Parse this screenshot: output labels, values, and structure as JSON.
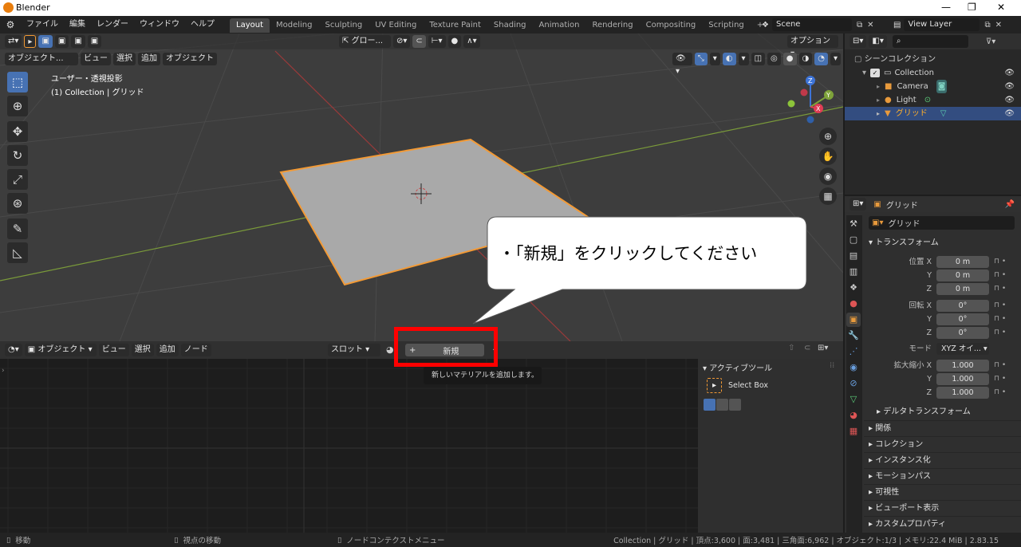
{
  "window": {
    "title": "Blender"
  },
  "menubar": {
    "menus": [
      "ファイル",
      "編集",
      "レンダー",
      "ウィンドウ",
      "ヘルプ"
    ],
    "workspaces": [
      "Layout",
      "Modeling",
      "Sculpting",
      "UV Editing",
      "Texture Paint",
      "Shading",
      "Animation",
      "Rendering",
      "Compositing",
      "Scripting"
    ],
    "add_tab": "+",
    "scene": "Scene",
    "view_layer": "View Layer"
  },
  "viewport": {
    "mode": "オブジェクト...",
    "menus": [
      "ビュー",
      "選択",
      "追加",
      "オブジェクト"
    ],
    "transform_orientation": "グロー...",
    "options": "オプション",
    "view_name": "ユーザー・透視投影",
    "view_info": "(1) Collection | グリッド",
    "gizmo": {
      "z": "Z",
      "y": "Y",
      "x": "X"
    }
  },
  "callout": {
    "text": "・「新規」をクリックしてください"
  },
  "node_editor": {
    "mode": "オブジェクト",
    "menus": [
      "ビュー",
      "選択",
      "追加",
      "ノード"
    ],
    "slot": "スロット",
    "new_plus": "+",
    "new_label": "新規",
    "tooltip": "新しいマテリアルを追加します。",
    "active_tool_title": "アクティブツール",
    "active_tool_name": "Select Box"
  },
  "outliner": {
    "root": "シーンコレクション",
    "collection": "Collection",
    "items": [
      {
        "name": "Camera"
      },
      {
        "name": "Light"
      },
      {
        "name": "グリッド"
      }
    ]
  },
  "properties": {
    "object_name": "グリッド",
    "object_field": "グリッド",
    "transform_title": "トランスフォーム",
    "location": {
      "label_x": "位置 X",
      "label_y": "Y",
      "label_z": "Z",
      "x": "0 m",
      "y": "0 m",
      "z": "0 m"
    },
    "rotation": {
      "label_x": "回転 X",
      "label_y": "Y",
      "label_z": "Z",
      "x": "0°",
      "y": "0°",
      "z": "0°"
    },
    "mode": {
      "label": "モード",
      "value": "XYZ オイ..."
    },
    "scale": {
      "label_x": "拡大縮小 X",
      "label_y": "Y",
      "label_z": "Z",
      "x": "1.000",
      "y": "1.000",
      "z": "1.000"
    },
    "delta": "デルタトランスフォーム",
    "panels": [
      "関係",
      "コレクション",
      "インスタンス化",
      "モーションパス",
      "可視性",
      "ビューポート表示",
      "カスタムプロパティ"
    ]
  },
  "statusbar": {
    "left1": "移動",
    "left2": "視点の移動",
    "left3": "ノードコンテクストメニュー",
    "right": "Collection | グリッド | 頂点:3,600 | 面:3,481 | 三角面:6,962 | オブジェクト:1/3 | メモリ:22.4 MiB | 2.83.15"
  },
  "colors": {
    "accent": "#4772b3",
    "highlight_red": "#ff0000",
    "selection_orange": "#f39a35"
  }
}
